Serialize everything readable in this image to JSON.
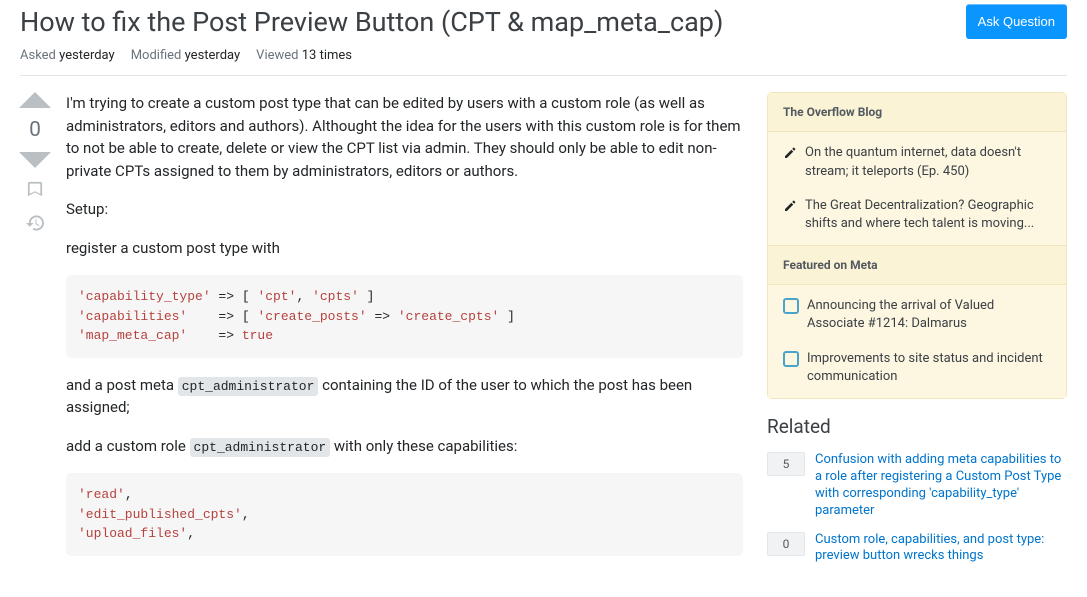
{
  "header": {
    "title": "How to fix the Post Preview Button (CPT & map_meta_cap)",
    "ask_button": "Ask Question"
  },
  "meta": {
    "asked_label": "Asked",
    "asked_value": "yesterday",
    "modified_label": "Modified",
    "modified_value": "yesterday",
    "viewed_label": "Viewed",
    "viewed_value": "13 times"
  },
  "vote": {
    "count": "0"
  },
  "post": {
    "p1": "I'm trying to create a custom post type that can be edited by users with a custom role (as well as administrators, editors and authors). Althought the idea for the users with this custom role is for them to not be able to create, delete or view the CPT list via admin. They should only be able to edit non-private CPTs assigned to them by administrators, editors or authors.",
    "p2": "Setup:",
    "p3": "register a custom post type with",
    "code1_raw": "'capability_type' => [ 'cpt', 'cpts' ]\n'capabilities'    => [ 'create_posts' => 'create_cpts' ]\n'map_meta_cap'    => true",
    "p4_a": "and a post meta ",
    "p4_code": "cpt_administrator",
    "p4_b": " containing the ID of the user to which the post has been assigned;",
    "p5_a": "add a custom role ",
    "p5_code": "cpt_administrator",
    "p5_b": " with only these capabilities:",
    "code2_raw": "'read',\n'edit_published_cpts',\n'upload_files',"
  },
  "sidebar": {
    "overflow_title": "The Overflow Blog",
    "blog_items": [
      "On the quantum internet, data doesn't stream; it teleports (Ep. 450)",
      "The Great Decentralization? Geographic shifts and where tech talent is moving..."
    ],
    "featured_title": "Featured on Meta",
    "meta_items": [
      "Announcing the arrival of Valued Associate #1214: Dalmarus",
      "Improvements to site status and incident communication"
    ]
  },
  "related": {
    "title": "Related",
    "items": [
      {
        "score": "5",
        "answered": false,
        "text": "Confusion with adding meta capabilities to a role after registering a Custom Post Type with corresponding 'capability_type' parameter"
      },
      {
        "score": "0",
        "answered": false,
        "text": "Custom role, capabilities, and post type: preview button wrecks things"
      }
    ]
  }
}
